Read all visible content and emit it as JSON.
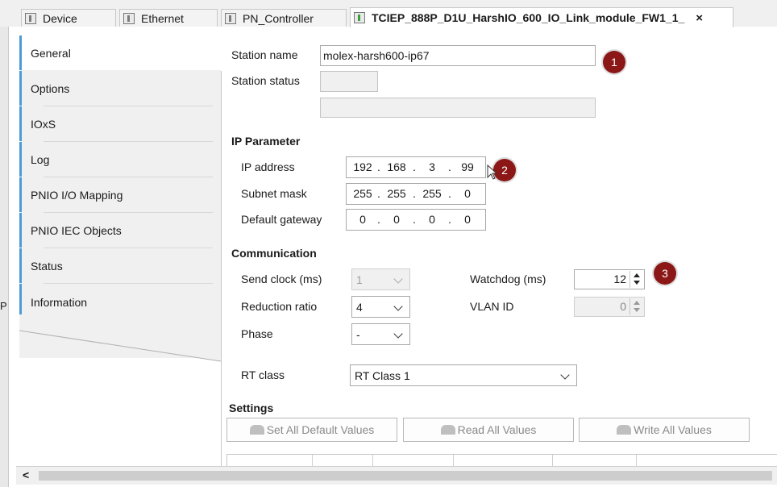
{
  "tabs": [
    {
      "label": "Device",
      "icon": "device-icon"
    },
    {
      "label": "Ethernet",
      "icon": "device-icon"
    },
    {
      "label": "PN_Controller",
      "icon": "device-icon"
    },
    {
      "label": "TCIEP_888P_D1U_HarshIO_600_IO_Link_module_FW1_1_",
      "icon": "device-green-icon",
      "close": "×"
    }
  ],
  "sidebar": {
    "items": [
      {
        "label": "General"
      },
      {
        "label": "Options"
      },
      {
        "label": "IOxS"
      },
      {
        "label": "Log"
      },
      {
        "label": "PNIO I/O Mapping"
      },
      {
        "label": "PNIO IEC Objects"
      },
      {
        "label": "Status"
      },
      {
        "label": "Information"
      }
    ],
    "edge_letter": "P"
  },
  "general": {
    "station_name_label": "Station name",
    "station_name_value": "molex-harsh600-ip67",
    "station_status_label": "Station status",
    "station_status_value": "",
    "status_text_value": ""
  },
  "ip": {
    "header": "IP Parameter",
    "address_label": "IP address",
    "address": [
      "192",
      "168",
      "3",
      "99"
    ],
    "subnet_label": "Subnet mask",
    "subnet": [
      "255",
      "255",
      "255",
      "0"
    ],
    "gateway_label": "Default gateway",
    "gateway": [
      "0",
      "0",
      "0",
      "0"
    ]
  },
  "comm": {
    "header": "Communication",
    "send_clock_label": "Send clock (ms)",
    "send_clock_value": "1",
    "reduction_label": "Reduction ratio",
    "reduction_value": "4",
    "phase_label": "Phase",
    "phase_value": "-",
    "watchdog_label": "Watchdog (ms)",
    "watchdog_value": "12",
    "vlan_label": "VLAN ID",
    "vlan_value": "0",
    "rt_class_label": "RT class",
    "rt_class_value": "RT Class 1"
  },
  "settings": {
    "header": "Settings",
    "set_default_label": "Set All Default Values",
    "read_all_label": "Read All Values",
    "write_all_label": "Write All Values"
  },
  "markers": [
    "1",
    "2",
    "3"
  ],
  "scroll": {
    "left_arrow": "<"
  },
  "colors": {
    "accent": "#4d9bd6",
    "marker": "#8b1717"
  }
}
